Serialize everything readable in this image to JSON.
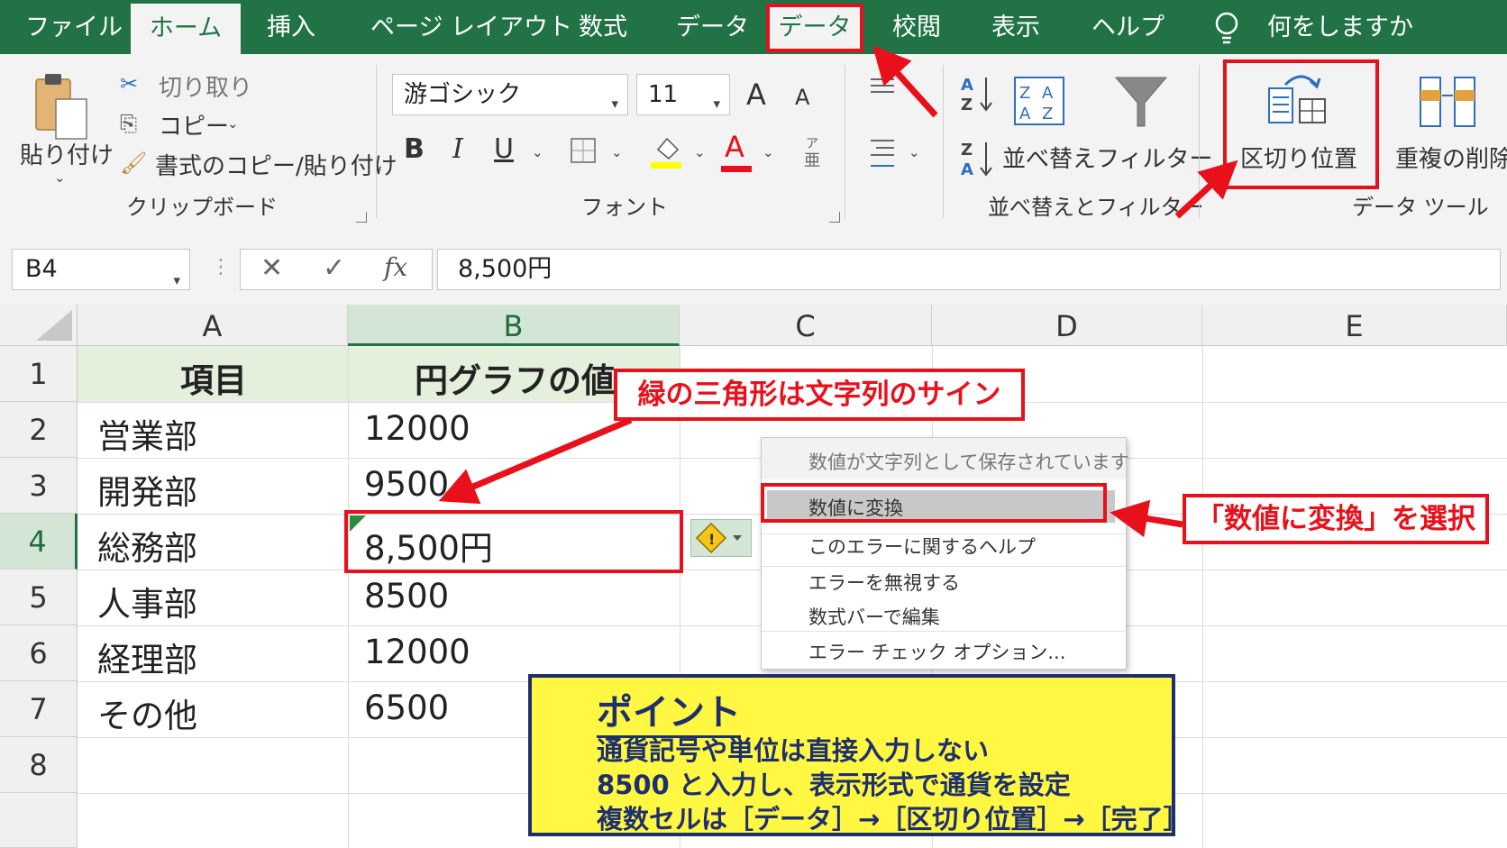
{
  "tabs": [
    "ファイル",
    "ホーム",
    "挿入",
    "ページ レイアウト",
    "数式",
    "データ",
    "データ",
    "校閲",
    "表示",
    "ヘルプ"
  ],
  "tell_me": "何をしますか",
  "clipboard": {
    "paste": "貼り付け",
    "cut": "切り取り",
    "copy": "コピー",
    "format_painter": "書式のコピー/貼り付け",
    "group": "クリップボード"
  },
  "font": {
    "name": "游ゴシック",
    "size": "11",
    "bold": "B",
    "italic": "I",
    "underline": "U",
    "font_color": "A",
    "grow": "A",
    "shrink": "A",
    "group": "フォント"
  },
  "sort_filter": {
    "sort": "並べ替え",
    "filter": "フィルター",
    "group": "並べ替えとフィルター"
  },
  "data_tools": {
    "text_to_columns": "区切り位置",
    "remove_duplicates": "重複の削除",
    "group": "データ ツール"
  },
  "formula_bar": {
    "name_box": "B4",
    "fx": "fx",
    "value": "8,500円"
  },
  "columns": [
    "A",
    "B",
    "C",
    "D",
    "E"
  ],
  "rows": [
    "1",
    "2",
    "3",
    "4",
    "5",
    "6",
    "7",
    "8"
  ],
  "table": {
    "header_a": "項目",
    "header_b": "円グラフの値",
    "rows": [
      {
        "a": "営業部",
        "b": "12000"
      },
      {
        "a": "開発部",
        "b": "9500"
      },
      {
        "a": "総務部",
        "b": "8,500円"
      },
      {
        "a": "人事部",
        "b": "8500"
      },
      {
        "a": "経理部",
        "b": "12000"
      },
      {
        "a": "その他",
        "b": "6500"
      }
    ]
  },
  "context_menu": {
    "title": "数値が文字列として保存されています",
    "items": [
      "数値に変換",
      "このエラーに関するヘルプ",
      "エラーを無視する",
      "数式バーで編集",
      "エラー チェック オプション..."
    ]
  },
  "annotations": {
    "green_triangle_note": "緑の三角形は文字列のサイン",
    "select_note": "「数値に変換」を選択",
    "point_title": "ポイント",
    "point_lines": [
      "通貨記号や単位は直接入力しない",
      "8500 と入力し、表示形式で通貨を設定",
      "複数セルは［データ］→［区切り位置］→［完了］"
    ]
  },
  "colors": {
    "excel_green": "#217346",
    "annotation_red": "#e8101a",
    "point_yellow": "#fff741",
    "point_navy": "#1d2f6f"
  }
}
